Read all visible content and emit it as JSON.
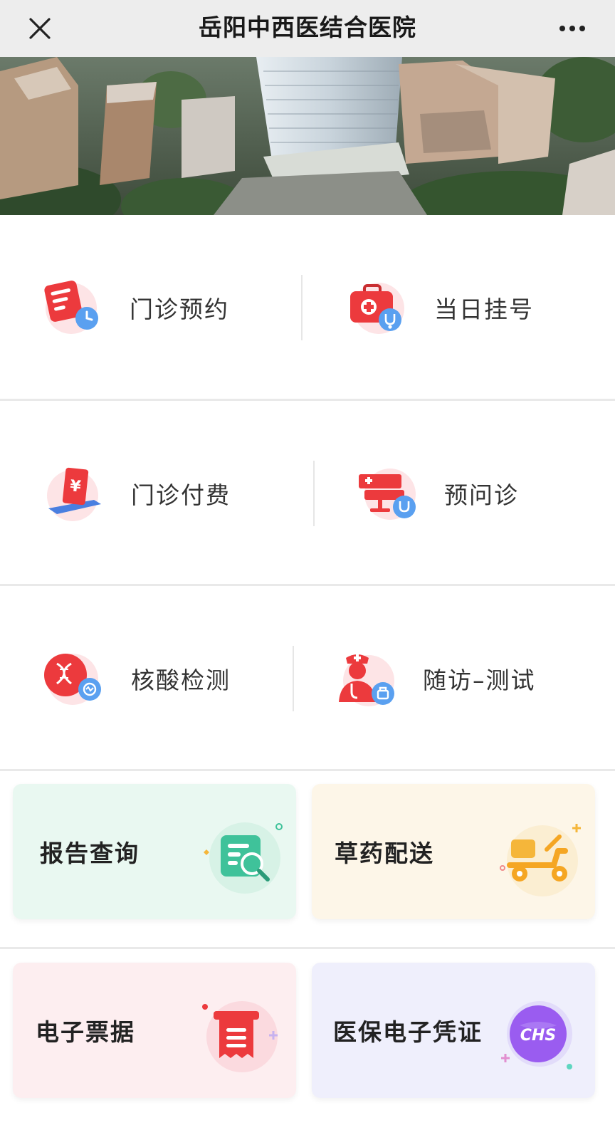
{
  "window": {
    "title": "岳阳中西医结合医院",
    "close_icon": "close-icon",
    "more_icon": "more-dots-icon"
  },
  "banner": {
    "description_icon": "hospital-building-photo"
  },
  "services": {
    "outpatient_appointment": {
      "label": "门诊预约",
      "icon": "clipboard-clock-icon"
    },
    "same_day_registration": {
      "label": "当日挂号",
      "icon": "medical-kit-icon"
    },
    "outpatient_payment": {
      "label": "门诊付费",
      "icon": "yuan-payment-icon"
    },
    "pre_consultation": {
      "label": "预问诊",
      "icon": "monitor-stethoscope-icon"
    },
    "nucleic_acid_test": {
      "label": "核酸检测",
      "icon": "dna-test-icon"
    },
    "follow_up_test": {
      "label": "随访–测试",
      "icon": "nurse-followup-icon"
    }
  },
  "cards": {
    "report_query": {
      "label": "报告查询",
      "icon": "report-search-icon",
      "bg": "#e9f8f1"
    },
    "herbal_delivery": {
      "label": "草药配送",
      "icon": "scooter-delivery-icon",
      "bg": "#fdf6e8"
    },
    "e_receipt": {
      "label": "电子票据",
      "icon": "receipt-icon",
      "bg": "#fdeef0"
    },
    "medical_insurance_voucher": {
      "label": "医保电子凭证",
      "icon": "chs-insurance-icon",
      "bg": "#efeffc"
    }
  },
  "colors": {
    "accent_red": "#ec3a3d",
    "accent_blue": "#4a90e2",
    "green": "#3fc29a",
    "orange": "#f5b63a",
    "purple": "#8a5cf0"
  }
}
